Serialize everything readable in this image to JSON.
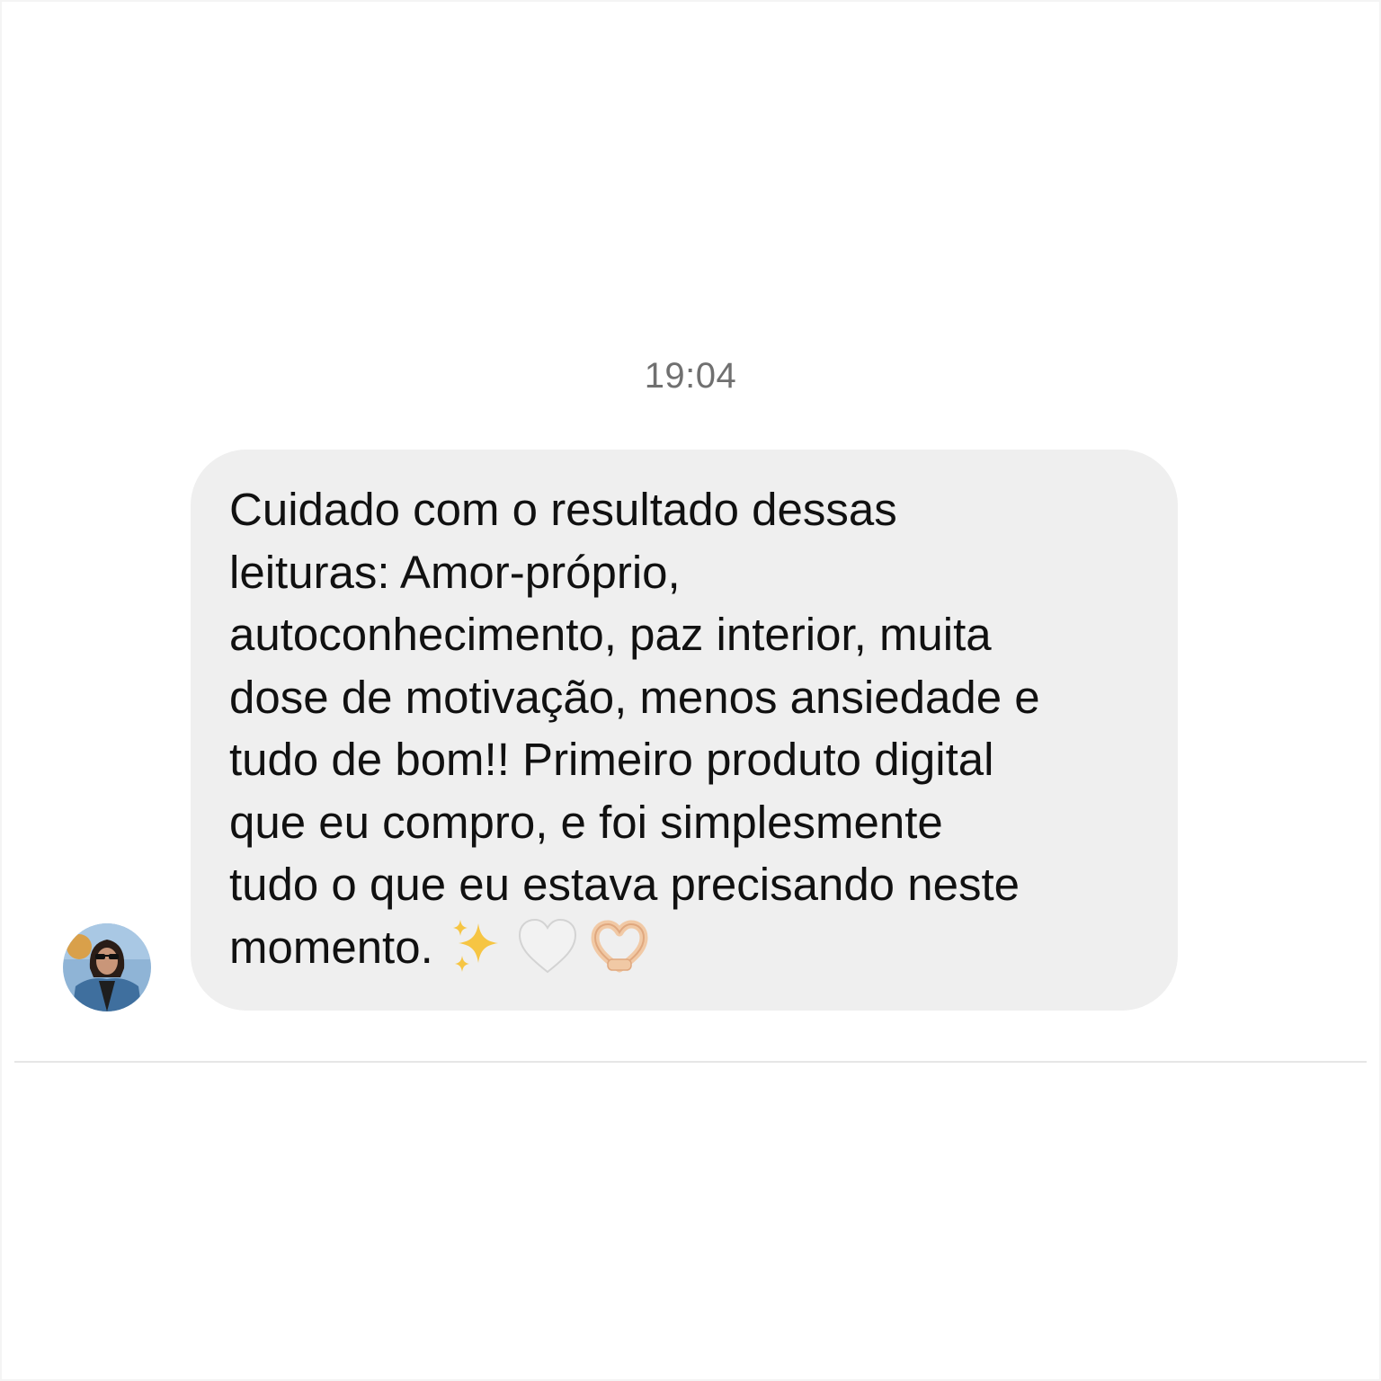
{
  "chat": {
    "timestamp": "19:04",
    "message": {
      "text": "Cuidado com o resultado dessas\nleituras: Amor-próprio,\nautoconhecimento, paz interior, muita\ndose de motivação, menos ansiedade e\ntudo de bom!! Primeiro produto digital\nque eu compro, e foi simplesmente\ntudo o que eu estava precisando neste\nmomento.",
      "emojis": [
        "sparkles-icon",
        "white-heart-icon",
        "heart-hands-icon"
      ]
    },
    "sender": {
      "avatar": "avatar"
    }
  },
  "colors": {
    "bubble_background": "#efefef",
    "timestamp_text": "#707070",
    "message_text": "#111111",
    "divider": "#e6e6e6"
  }
}
